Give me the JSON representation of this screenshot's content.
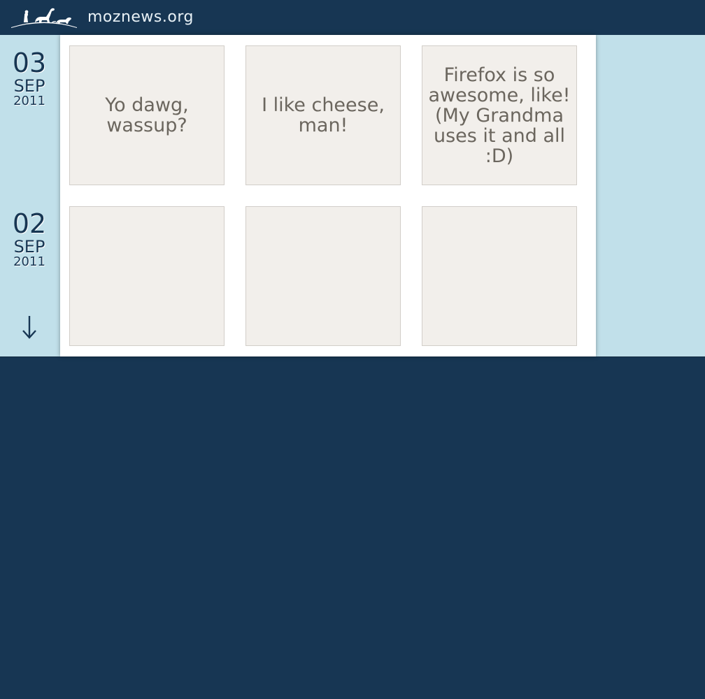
{
  "header": {
    "site_name": "moznews.org",
    "logo_icon": "mozilla-dinosaur-family-logo"
  },
  "dates": [
    {
      "day": "03",
      "month": "SEP",
      "year": "2011"
    },
    {
      "day": "02",
      "month": "SEP",
      "year": "2011"
    }
  ],
  "nav": {
    "down_icon": "down-arrow-icon"
  },
  "rows": [
    {
      "tiles": [
        {
          "text": "Yo dawg, wassup?"
        },
        {
          "text": "I like cheese, man!"
        },
        {
          "text": "Firefox is so awesome, like! (My Grandma uses it and all :D)"
        }
      ]
    },
    {
      "tiles": [
        {
          "text": ""
        },
        {
          "text": ""
        },
        {
          "text": ""
        }
      ]
    }
  ],
  "colors": {
    "navy": "#173653",
    "light_blue": "#c1e0ea",
    "tile_bg": "#f2efeb",
    "tile_text": "#6b665e"
  }
}
